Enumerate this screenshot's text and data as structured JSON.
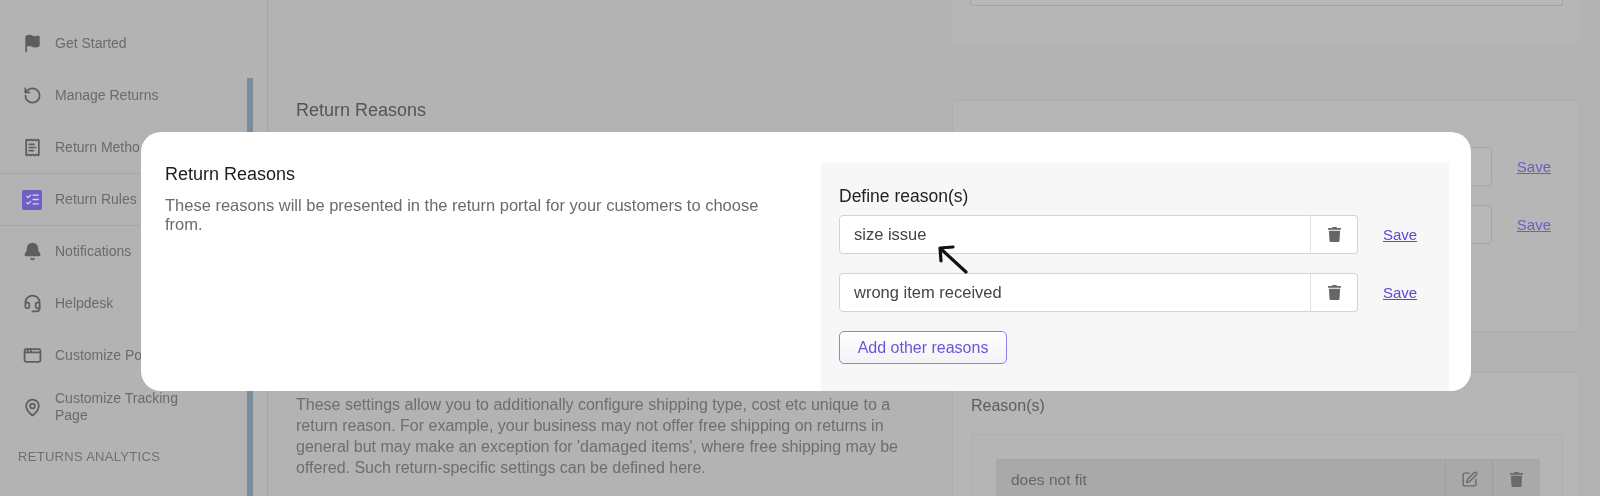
{
  "sidebar": {
    "items": [
      {
        "label": "Get Started",
        "selected": false
      },
      {
        "label": "Manage Returns",
        "selected": false
      },
      {
        "label": "Return Metho",
        "selected": false
      },
      {
        "label": "Return Rules",
        "selected": true
      },
      {
        "label": "Notifications",
        "selected": false
      },
      {
        "label": "Helpdesk",
        "selected": false
      },
      {
        "label": "Customize Po",
        "selected": false
      },
      {
        "label": "Customize Tracking Page",
        "selected": false
      }
    ],
    "section_heading": "RETURNS ANALYTICS"
  },
  "page": {
    "section_title": "Return Reasons",
    "reasons_card": {
      "rows": [
        {
          "save": "Save"
        },
        {
          "save": "Save"
        }
      ]
    },
    "description": "These settings allow you to additionally configure shipping type, cost etc unique to a return reason. For example, your business may not offer free shipping on returns in general but may make an exception for 'damaged items', where free shipping may be offered. Such return-specific settings can be defined here.",
    "reasons_list": {
      "title": "Reason(s)",
      "rows": [
        {
          "value": "does not fit"
        }
      ]
    }
  },
  "modal": {
    "title": "Return Reasons",
    "description": "These reasons will be presented in the return portal for your customers to choose from.",
    "panel": {
      "label": "Define reason(s)",
      "reasons": [
        {
          "value": "size issue",
          "save": "Save"
        },
        {
          "value": "wrong item received",
          "save": "Save"
        }
      ],
      "add_button": "Add other reasons"
    }
  }
}
